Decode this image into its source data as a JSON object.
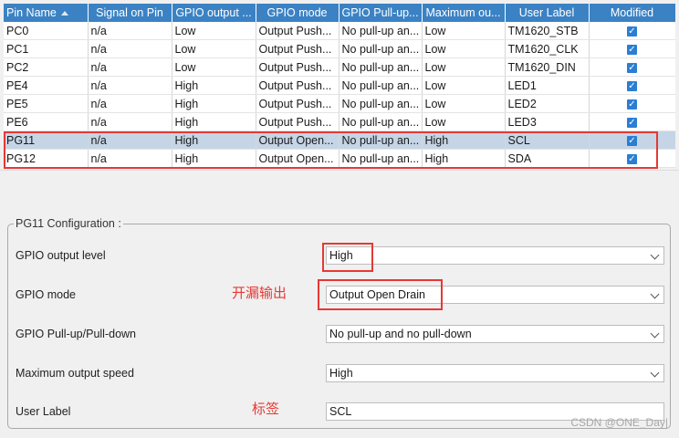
{
  "table": {
    "columns": [
      "Pin Name",
      "Signal on Pin",
      "GPIO output ...",
      "GPIO mode",
      "GPIO Pull-up...",
      "Maximum ou...",
      "User Label",
      "Modified"
    ],
    "rows": [
      {
        "pin": "PC0",
        "signal": "n/a",
        "output": "Low",
        "mode": "Output Push...",
        "pull": "No pull-up an...",
        "speed": "Low",
        "label": "TM1620_STB",
        "modified": true,
        "selected": false
      },
      {
        "pin": "PC1",
        "signal": "n/a",
        "output": "Low",
        "mode": "Output Push...",
        "pull": "No pull-up an...",
        "speed": "Low",
        "label": "TM1620_CLK",
        "modified": true,
        "selected": false
      },
      {
        "pin": "PC2",
        "signal": "n/a",
        "output": "Low",
        "mode": "Output Push...",
        "pull": "No pull-up an...",
        "speed": "Low",
        "label": "TM1620_DIN",
        "modified": true,
        "selected": false
      },
      {
        "pin": "PE4",
        "signal": "n/a",
        "output": "High",
        "mode": "Output Push...",
        "pull": "No pull-up an...",
        "speed": "Low",
        "label": "LED1",
        "modified": true,
        "selected": false
      },
      {
        "pin": "PE5",
        "signal": "n/a",
        "output": "High",
        "mode": "Output Push...",
        "pull": "No pull-up an...",
        "speed": "Low",
        "label": "LED2",
        "modified": true,
        "selected": false
      },
      {
        "pin": "PE6",
        "signal": "n/a",
        "output": "High",
        "mode": "Output Push...",
        "pull": "No pull-up an...",
        "speed": "Low",
        "label": "LED3",
        "modified": true,
        "selected": false
      },
      {
        "pin": "PG11",
        "signal": "n/a",
        "output": "High",
        "mode": "Output Open...",
        "pull": "No pull-up an...",
        "speed": "High",
        "label": "SCL",
        "modified": true,
        "selected": true
      },
      {
        "pin": "PG12",
        "signal": "n/a",
        "output": "High",
        "mode": "Output Open...",
        "pull": "No pull-up an...",
        "speed": "High",
        "label": "SDA",
        "modified": true,
        "selected": false
      }
    ]
  },
  "config": {
    "title": "PG11 Configuration :",
    "fields": [
      {
        "label": "GPIO output level",
        "value": "High",
        "dropdown": true
      },
      {
        "label": "GPIO mode",
        "value": "Output Open Drain",
        "dropdown": true
      },
      {
        "label": "GPIO Pull-up/Pull-down",
        "value": "No pull-up and no pull-down",
        "dropdown": true
      },
      {
        "label": "Maximum output speed",
        "value": "High",
        "dropdown": true
      },
      {
        "label": "User Label",
        "value": "SCL",
        "dropdown": false
      }
    ]
  },
  "annotations": {
    "open_drain": "开漏输出",
    "label": "标签"
  },
  "watermark": "CSDN @ONE_Day|",
  "colors": {
    "header_bg": "#3b82c4",
    "selected_row": "#c5d5e6",
    "highlight": "#e53935",
    "checkbox": "#2a7ed3"
  }
}
